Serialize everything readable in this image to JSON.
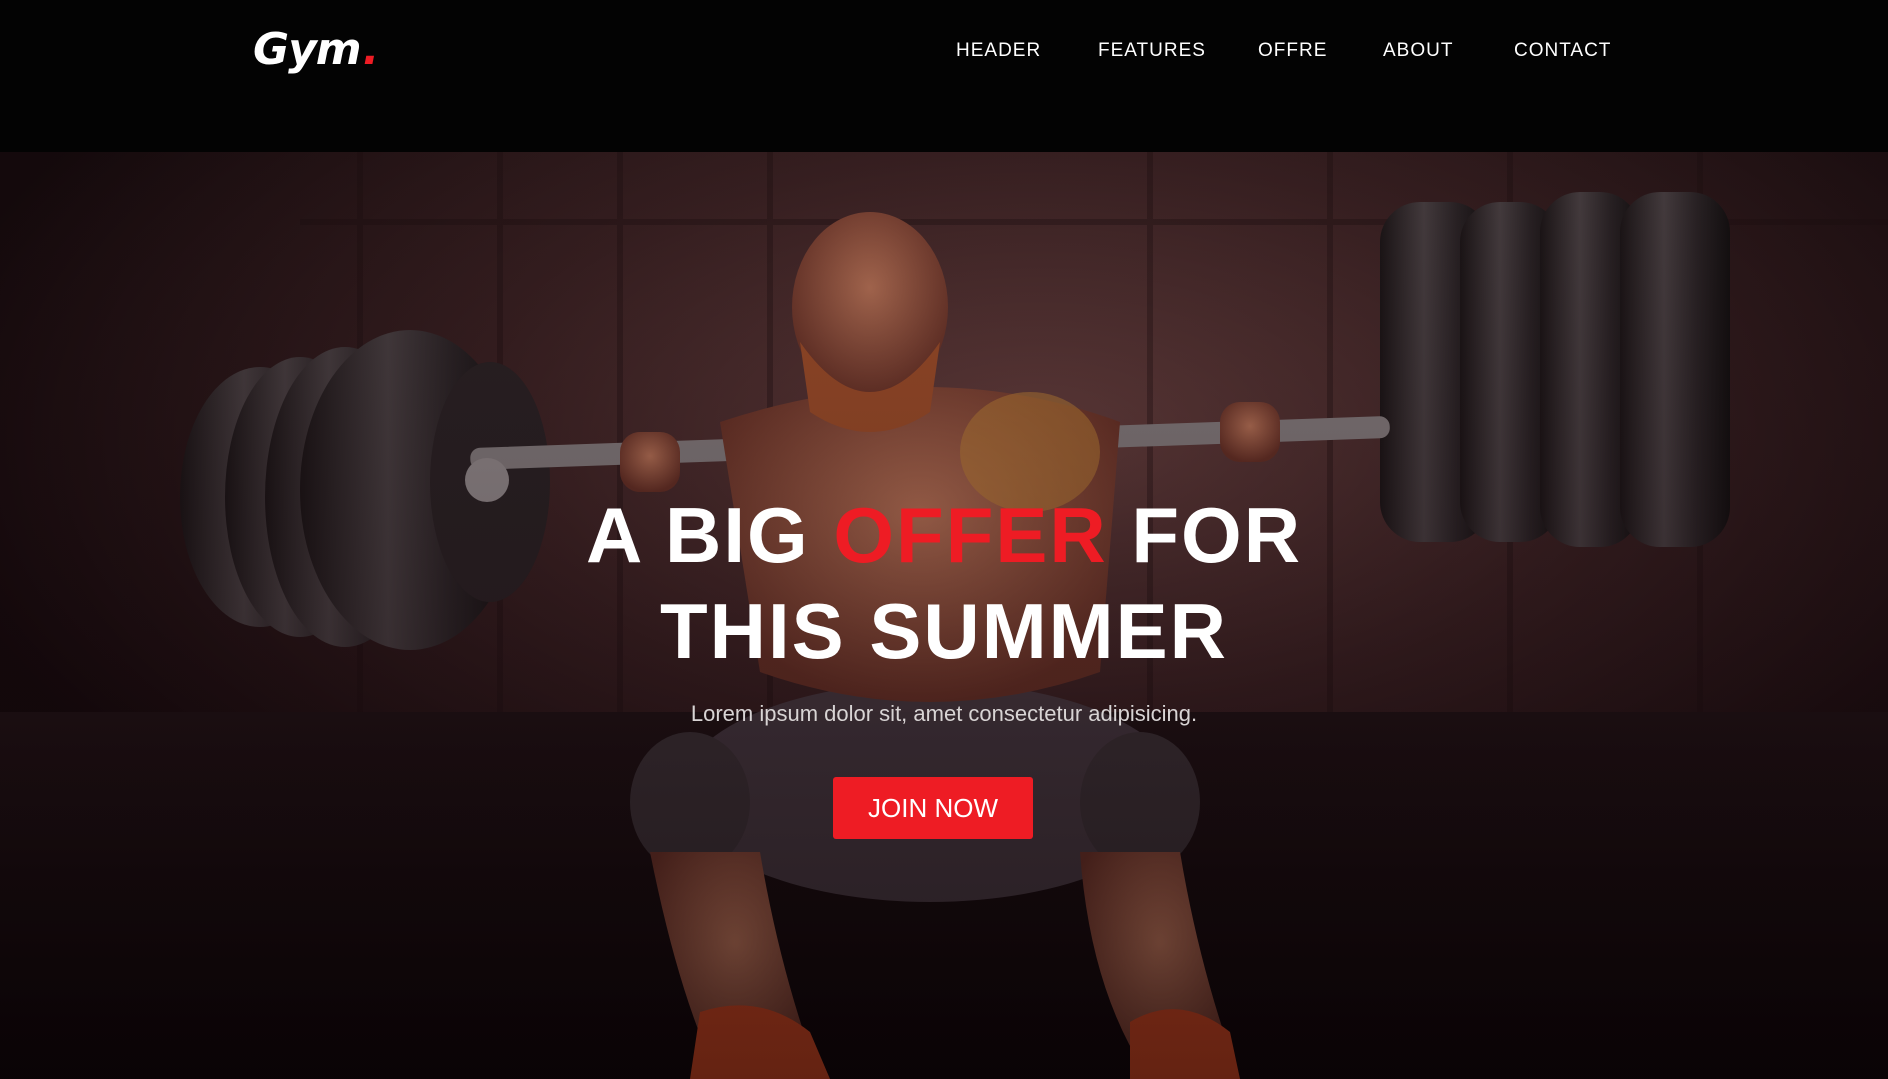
{
  "brand": {
    "name": "Gym",
    "dot": ".",
    "accent_color": "#ee1c24"
  },
  "nav": {
    "items": [
      {
        "label": "HEADER"
      },
      {
        "label": "FEATURES"
      },
      {
        "label": "OFFRE"
      },
      {
        "label": "ABOUT"
      },
      {
        "label": "CONTACT"
      }
    ]
  },
  "hero": {
    "title_part1": "A BIG ",
    "title_accent": "OFFER",
    "title_part2": " FOR",
    "title_line2": "THIS SUMMER",
    "subtitle": "Lorem ipsum dolor sit, amet consectetur adipisicing.",
    "cta_label": "JOIN NOW",
    "background_image": "weightlifter-squat-photo"
  }
}
